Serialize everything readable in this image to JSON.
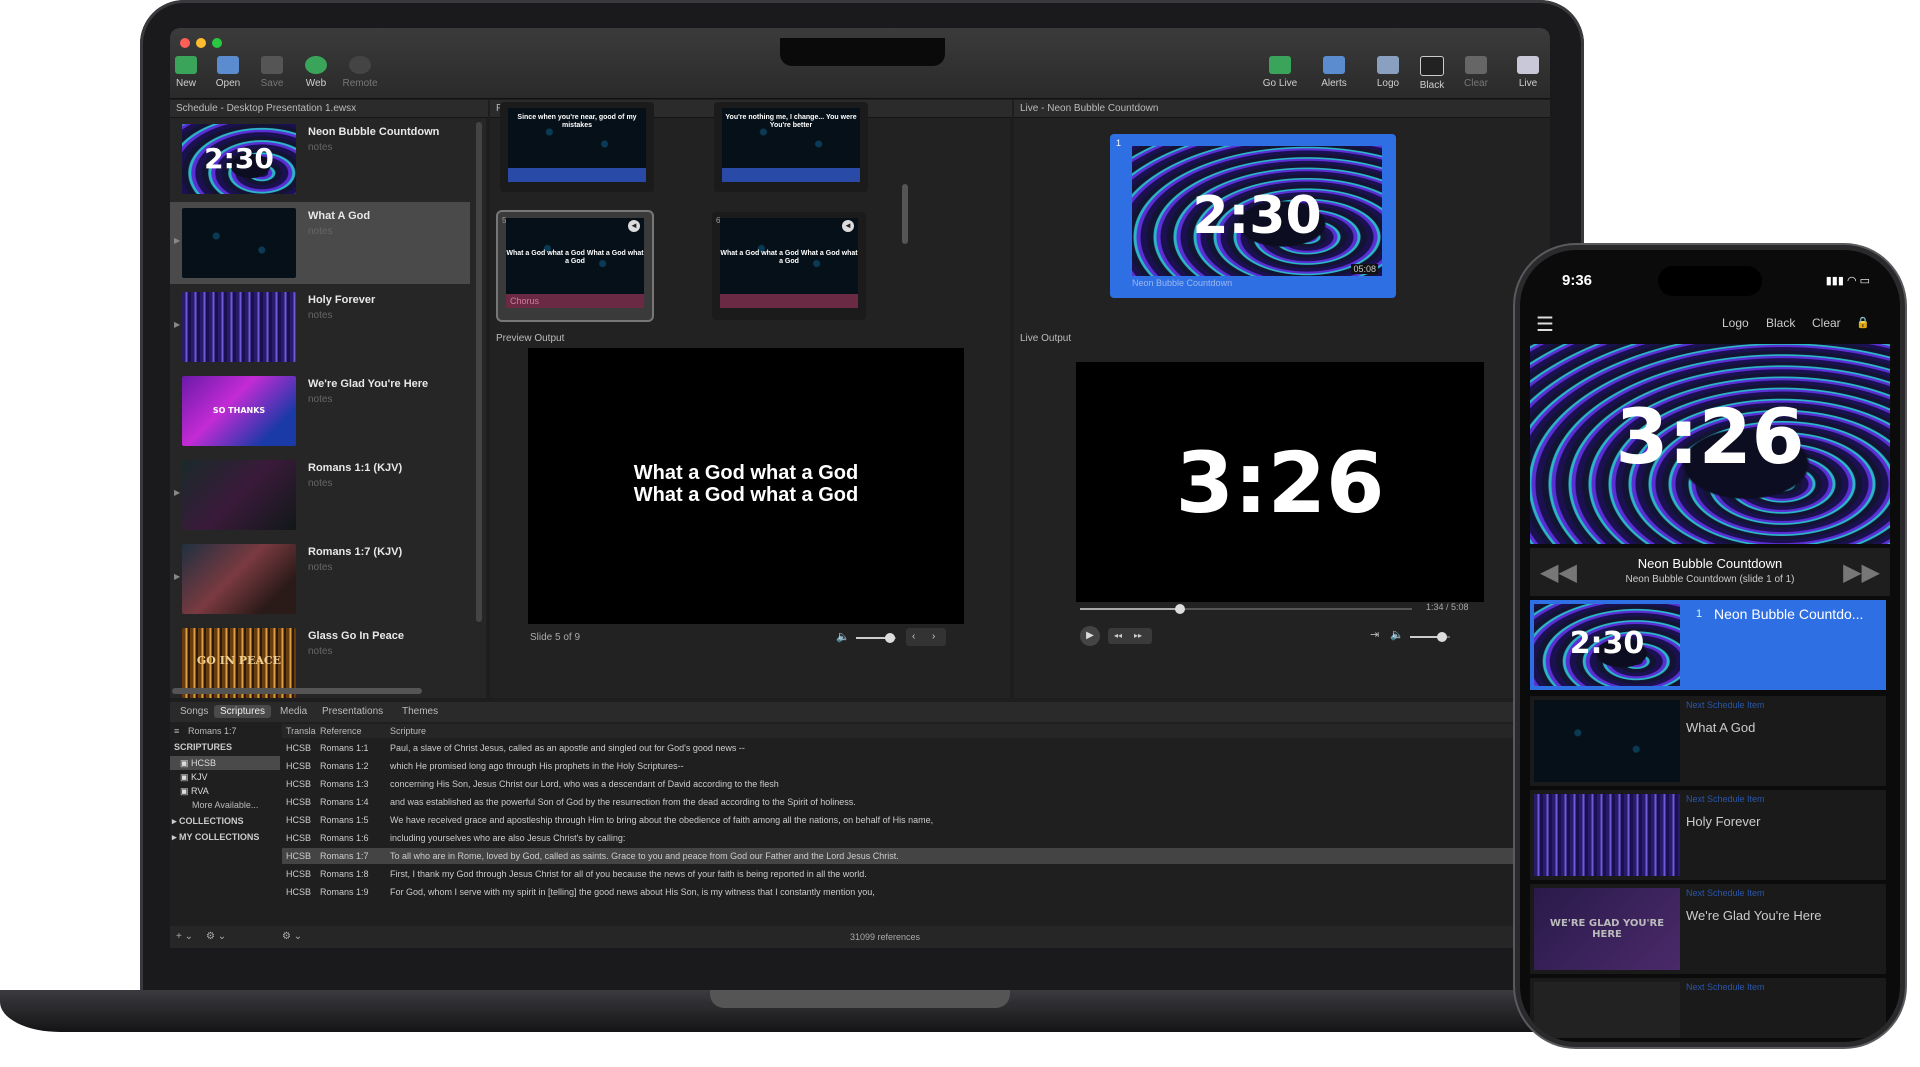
{
  "toolbar": {
    "new": "New",
    "open": "Open",
    "save": "Save",
    "web": "Web",
    "remote": "Remote",
    "go_live": "Go Live",
    "alerts": "Alerts",
    "logo": "Logo",
    "black": "Black",
    "clear": "Clear",
    "live": "Live"
  },
  "schedule": {
    "header": "Schedule - Desktop Presentation 1.ewsx",
    "items": [
      {
        "title": "Neon Bubble Countdown",
        "notes": "notes",
        "thumb_text": "2:30"
      },
      {
        "title": "What A God",
        "notes": "notes"
      },
      {
        "title": "Holy Forever",
        "notes": "notes"
      },
      {
        "title": "We're Glad You're Here",
        "notes": "notes",
        "thumb_text": "SO THANKS"
      },
      {
        "title": "Romans 1:1 (KJV)",
        "notes": "notes"
      },
      {
        "title": "Romans 1:7 (KJV)",
        "notes": "notes"
      },
      {
        "title": "Glass Go In Peace",
        "notes": "notes",
        "thumb_text": "GO IN PEACE"
      }
    ]
  },
  "preview": {
    "header": "Preview - What A God",
    "top_left_text": "Since when you're near, good of my mistakes",
    "top_right_text": "You're nothing me, I change... You were You're better",
    "slide5_num": "5",
    "slide6_num": "6",
    "slide_text": "What a God what a God What a God what a God",
    "slide5_label": "Chorus",
    "output_label": "Preview Output",
    "output_line1": "What a God what a God",
    "output_line2": "What a God what a God",
    "slide_counter": "Slide 5 of 9",
    "preview_volume": 0.85
  },
  "live": {
    "header": "Live - Neon Bubble Countdown",
    "slide_num": "1",
    "slide_countdown": "2:30",
    "slide_duration": "05:08",
    "slide_label": "Neon Bubble Countdown",
    "output_label": "Live Output",
    "countdown": "3:26",
    "time": "1:34 / 5:08",
    "progress": 0.3,
    "volume": 0.8
  },
  "library": {
    "tabs": [
      "Songs",
      "Scriptures",
      "Media",
      "Presentations",
      "Themes"
    ],
    "selected_tab": "Scriptures",
    "search": "Romans 1:7",
    "columns": {
      "translation": "Transla",
      "reference": "Reference",
      "scripture": "Scripture"
    },
    "side": {
      "scriptures": "SCRIPTURES",
      "hcsb": "HCSB",
      "kjv": "KJV",
      "rva": "RVA",
      "more": "More Available...",
      "collections": "COLLECTIONS",
      "my_collections": "MY COLLECTIONS"
    },
    "rows": [
      {
        "t": "HCSB",
        "r": "Romans 1:1",
        "s": "Paul, a slave of Christ Jesus, called as an apostle and singled out for God's good news --"
      },
      {
        "t": "HCSB",
        "r": "Romans 1:2",
        "s": "which He promised long ago through His prophets in the Holy Scriptures--"
      },
      {
        "t": "HCSB",
        "r": "Romans 1:3",
        "s": "concerning His Son, Jesus Christ our Lord, who was a descendant of David according to the flesh"
      },
      {
        "t": "HCSB",
        "r": "Romans 1:4",
        "s": "and was established as the powerful Son of God by the resurrection from the dead according to the Spirit of holiness."
      },
      {
        "t": "HCSB",
        "r": "Romans 1:5",
        "s": "We have received grace and apostleship through Him to bring about the obedience of faith among all the nations, on behalf of His name,"
      },
      {
        "t": "HCSB",
        "r": "Romans 1:6",
        "s": "including yourselves who are also Jesus Christ's by calling:"
      },
      {
        "t": "HCSB",
        "r": "Romans 1:7",
        "s": "To all who are in Rome, loved by God, called as saints. Grace to you and peace from God our Father and the Lord Jesus Christ."
      },
      {
        "t": "HCSB",
        "r": "Romans 1:8",
        "s": "First, I thank my God through Jesus Christ for all of you because the news of your faith is being reported in all the world."
      },
      {
        "t": "HCSB",
        "r": "Romans 1:9",
        "s": "For God, whom I serve with my spirit in [telling] the good news about His Son, is my witness that I constantly mention you,"
      }
    ],
    "count": "31099 references"
  },
  "phone": {
    "time": "9:36",
    "logo": "Logo",
    "black": "Black",
    "clear": "Clear",
    "countdown": "3:26",
    "current_title": "Neon Bubble Countdown",
    "current_sub": "Neon Bubble Countdown (slide 1 of 1)",
    "slide_num": "1",
    "slide_name": "Neon Bubble Countdo...",
    "slide_countdown": "2:30",
    "next_label": "Next Schedule Item",
    "next_items": [
      "What A God",
      "Holy Forever",
      "We're Glad You're Here"
    ],
    "glad_thumb_text": "WE'RE GLAD YOU'RE HERE"
  },
  "colors": {
    "accent": "#2f6fe4",
    "selection": "#4a4a4a",
    "chorus": "#c04a74"
  }
}
